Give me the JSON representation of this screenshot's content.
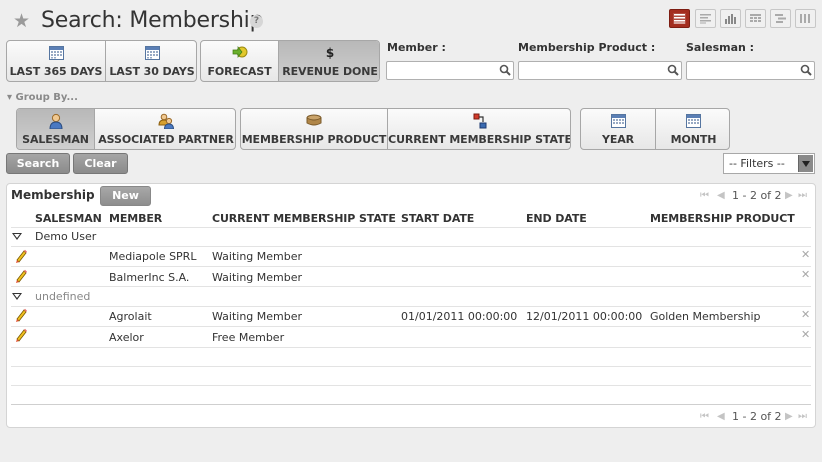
{
  "header": {
    "title": "Search: Membership",
    "help": "?",
    "view_icons": [
      "list-view-icon",
      "form-view-icon",
      "graph-view-icon",
      "calendar-view-icon",
      "gantt-view-icon",
      "kanban-view-icon"
    ]
  },
  "filters": {
    "period": [
      "LAST 365 DAYS",
      "LAST 30 DAYS"
    ],
    "state": [
      "FORECAST",
      "REVENUE DONE"
    ],
    "member_label": "Member :",
    "member_value": "",
    "product_label": "Membership Product :",
    "product_value": "",
    "salesman_label": "Salesman :",
    "salesman_value": ""
  },
  "group_by": {
    "toggle": "▾ Group By...",
    "partner": [
      "SALESMAN",
      "ASSOCIATED PARTNER"
    ],
    "membership": [
      "MEMBERSHIP PRODUCT",
      "CURRENT MEMBERSHIP STATE"
    ],
    "date": [
      "YEAR",
      "MONTH"
    ]
  },
  "actions": {
    "search": "Search",
    "clear": "Clear",
    "filters_select": "-- Filters --"
  },
  "list": {
    "caption": "Membership",
    "new_label": "New",
    "pager": "1 - 2 of 2",
    "columns": [
      "SALESMAN",
      "MEMBER",
      "CURRENT MEMBERSHIP STATE",
      "START DATE",
      "END DATE",
      "MEMBERSHIP PRODUCT"
    ],
    "groups": [
      {
        "name": "Demo User",
        "rows": [
          {
            "member": "Mediapole SPRL",
            "state": "Waiting Member",
            "start": "",
            "end": "",
            "product": ""
          },
          {
            "member": "BalmerInc S.A.",
            "state": "Waiting Member",
            "start": "",
            "end": "",
            "product": ""
          }
        ]
      },
      {
        "name": "undefined",
        "rows": [
          {
            "member": "Agrolait",
            "state": "Waiting Member",
            "start": "01/01/2011 00:00:00",
            "end": "12/01/2011 00:00:00",
            "product": "Golden Membership"
          },
          {
            "member": "Axelor",
            "state": "Free Member",
            "start": "",
            "end": "",
            "product": ""
          }
        ]
      }
    ]
  },
  "colors": {
    "active_view": "#a42d1f",
    "toggle_on": "#c0c0c0",
    "dark_button": "#9a9a9a"
  }
}
